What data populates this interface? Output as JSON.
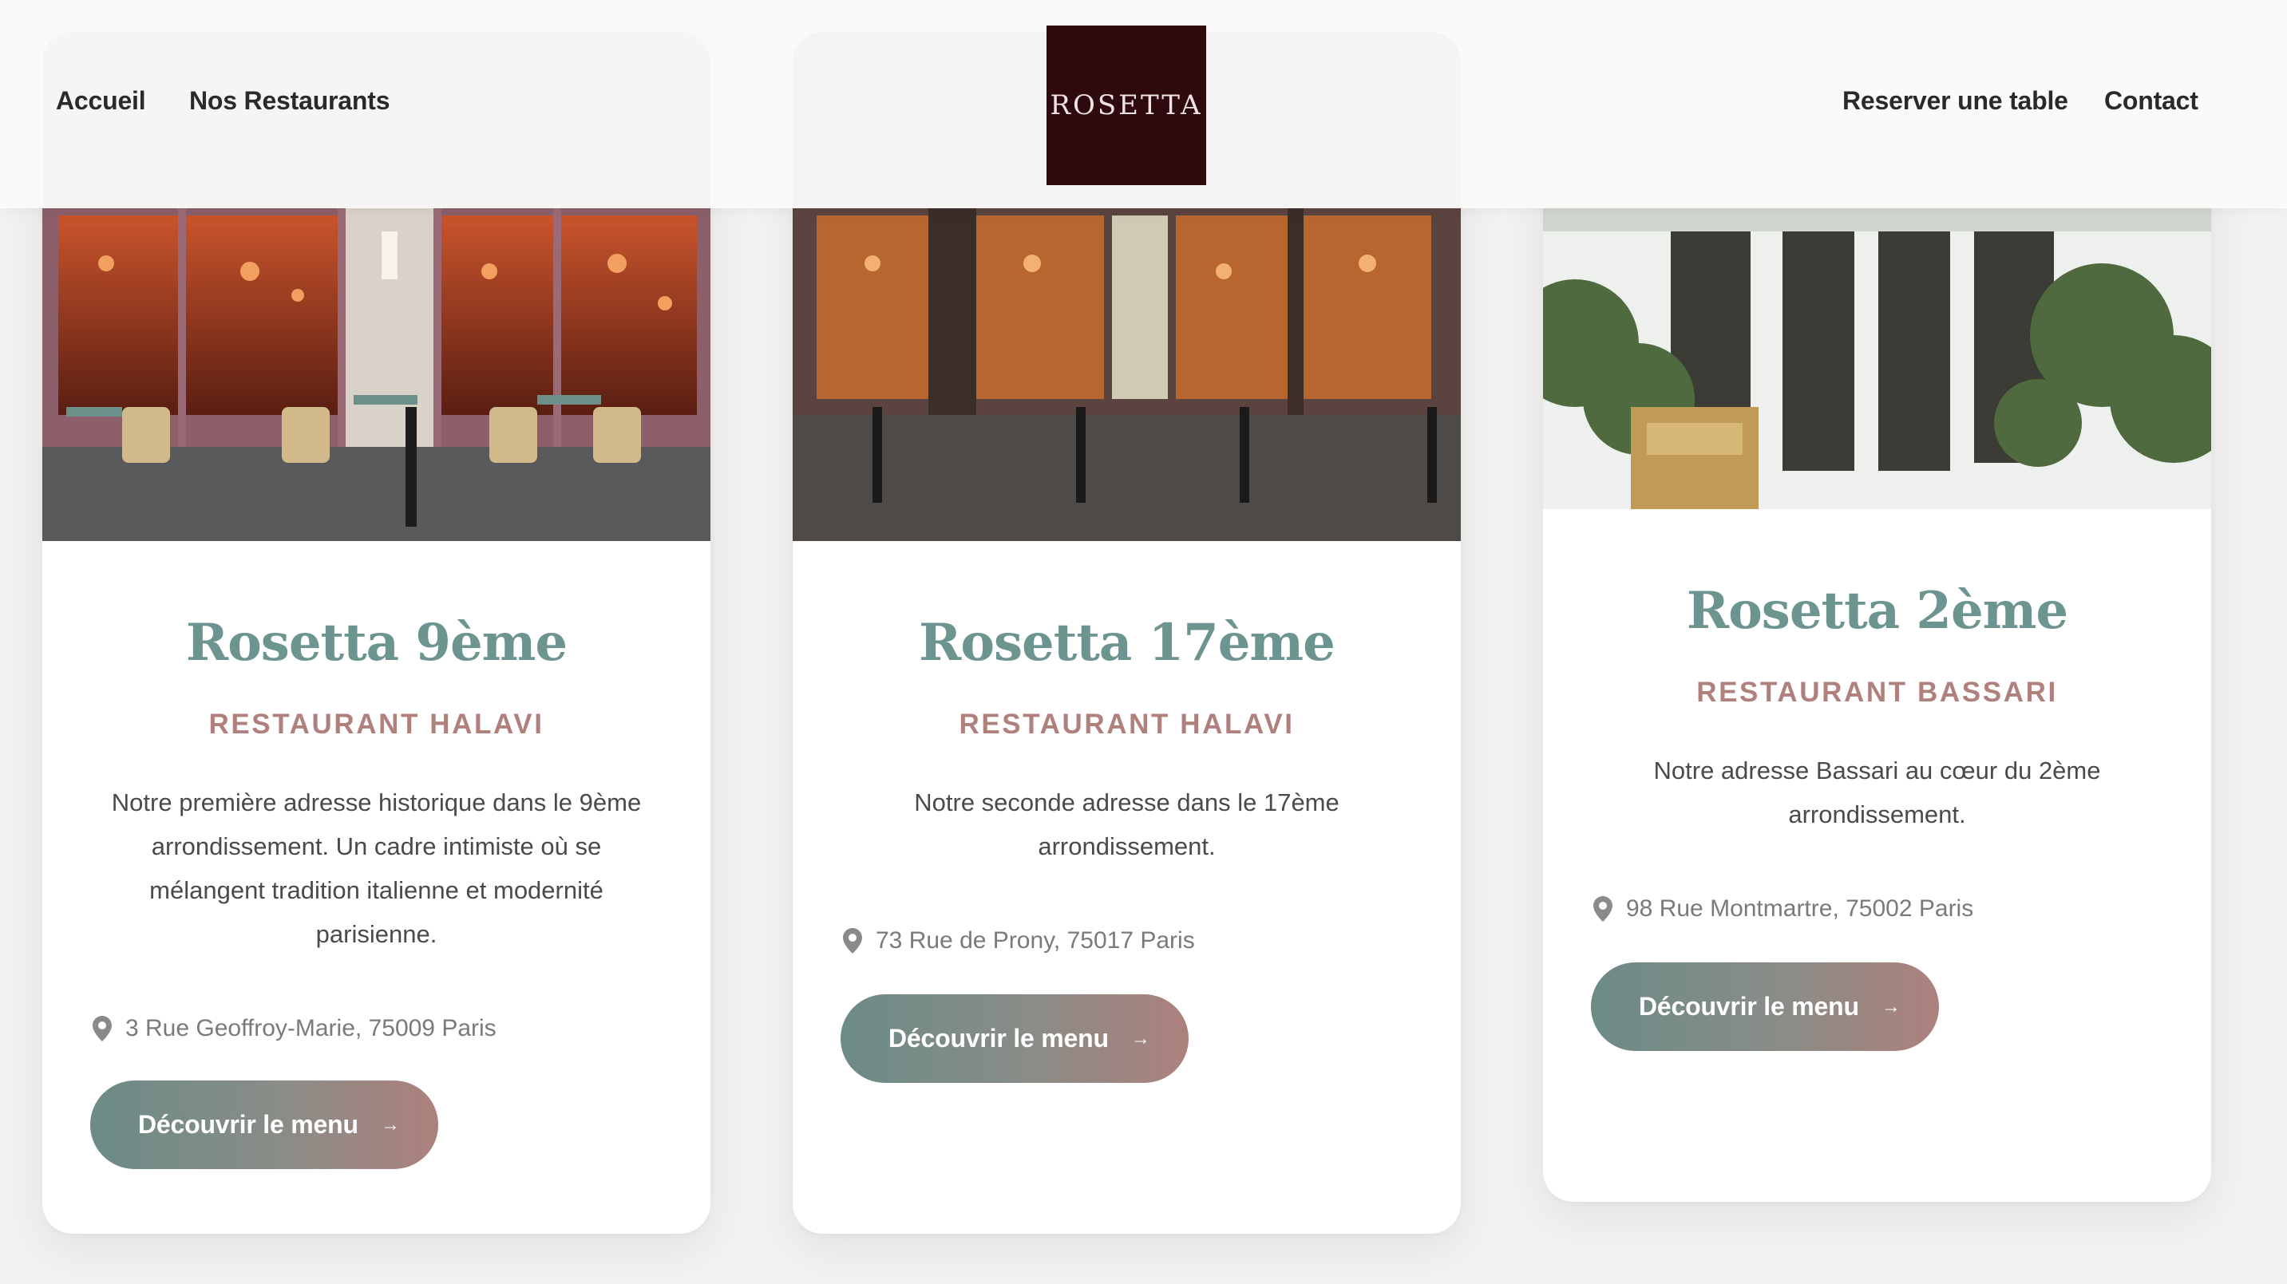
{
  "header": {
    "nav_left": [
      "Accueil",
      "Nos Restaurants"
    ],
    "nav_right": [
      "Reserver une table",
      "Contact"
    ],
    "logo_text": "ROSETTA"
  },
  "cards": [
    {
      "title": "Rosetta 9ème",
      "subtitle": "RESTAURANT HALAVI",
      "description": "Notre première adresse historique dans le 9ème arrondissement. Un cadre intimiste où se mélangent tradition italienne et modernité parisienne.",
      "address": "3 Rue Geoffroy-Marie, 75009 Paris",
      "button": "Découvrir le menu"
    },
    {
      "title": "Rosetta 17ème",
      "subtitle": "RESTAURANT HALAVI",
      "description": "Notre seconde adresse dans le 17ème arrondissement.",
      "address": "73 Rue de Prony, 75017 Paris",
      "button": "Découvrir le menu"
    },
    {
      "title": "Rosetta 2ème",
      "subtitle": "RESTAURANT BASSARI",
      "description": "Notre adresse Bassari au cœur du 2ème arrondissement.",
      "address": "98 Rue Montmartre, 75002 Paris",
      "button": "Découvrir le menu"
    }
  ],
  "colors": {
    "title": "#6d9590",
    "subtitle": "#b0817c",
    "logo_bg": "#2e0a0f",
    "button_start": "#6c8b87",
    "button_end": "#ad817d"
  },
  "icons": {
    "address": "map-pin-icon",
    "button": "arrow-right-icon"
  }
}
